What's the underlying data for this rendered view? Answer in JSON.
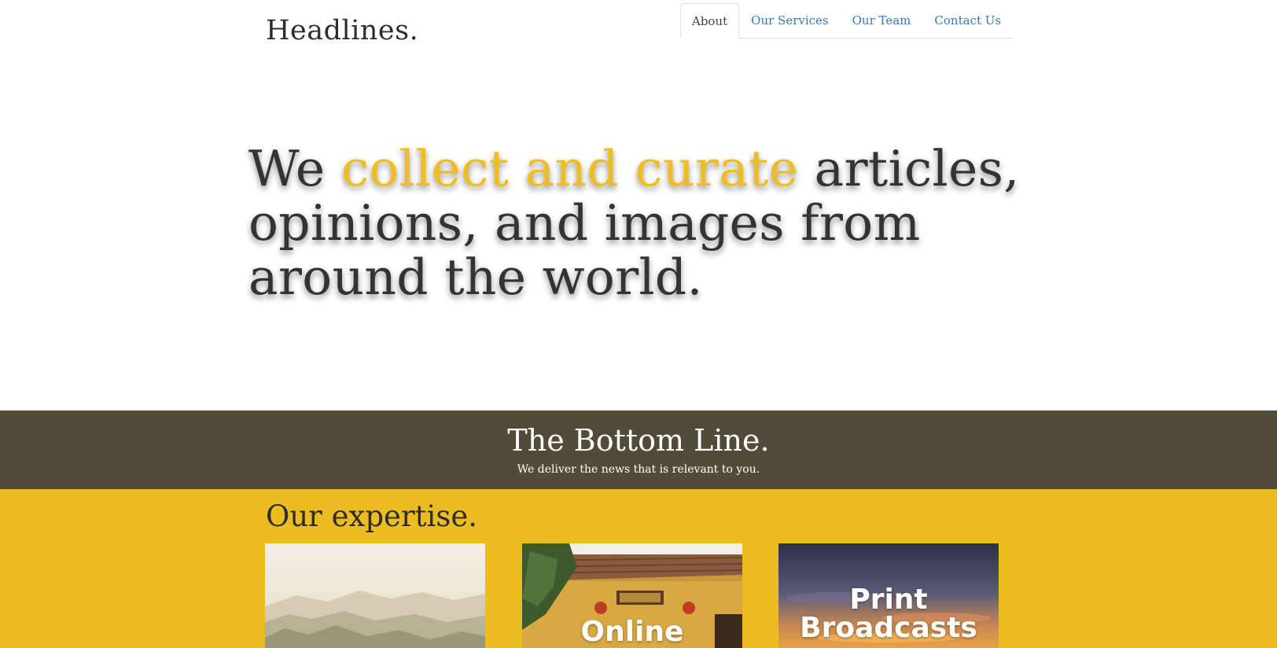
{
  "brand": "Headlines.",
  "nav": {
    "items": [
      "About",
      "Our Services",
      "Our Team",
      "Contact Us"
    ],
    "active": "About"
  },
  "hero": {
    "lead": "We ",
    "highlight": "collect and curate",
    "rest": " articles, opinions, and images from around the world."
  },
  "bottom_line": {
    "title": "The Bottom Line.",
    "subtitle": "We deliver the news that is relevant to you."
  },
  "expertise": {
    "title": "Our expertise.",
    "cards": [
      {
        "title": ""
      },
      {
        "title": "Online"
      },
      {
        "title": "Print Broadcasts"
      }
    ]
  },
  "colors": {
    "accent": "#f0bd21",
    "banner": "#524b37",
    "expertise_bg": "#ebbd22",
    "link": "#337ab7"
  }
}
